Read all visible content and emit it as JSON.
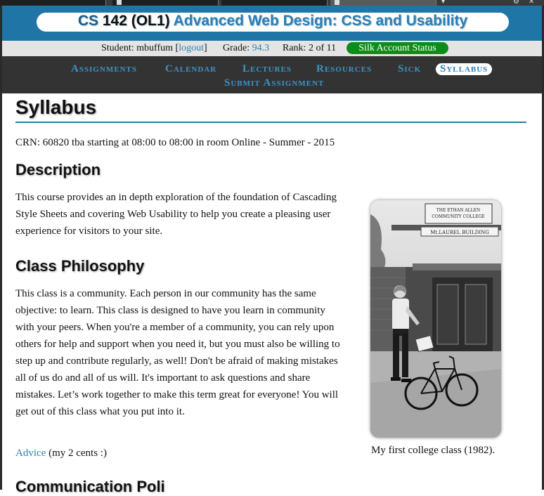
{
  "header": {
    "course_code": "CS",
    "course_number": "142",
    "section": "(OL1)",
    "course_title": "Advanced Web Design: CSS and Usability"
  },
  "userbar": {
    "student_label": "Student: mbuffum [",
    "logout_label": "logout",
    "student_suffix": "]",
    "grade_label": "Grade:",
    "grade_value": "94.3",
    "rank_label": "Rank: 2 of 11",
    "silk_button": "Silk Account Status"
  },
  "nav": {
    "items": [
      "Assignments",
      "Calendar",
      "Lectures",
      "Resources",
      "Sick",
      "Syllabus",
      "Submit Assignment"
    ],
    "active": "Syllabus"
  },
  "page": {
    "title": "Syllabus",
    "crn_line": "CRN: 60820 tba starting at 08:00 to 08:00 in room Online - Summer - 2015",
    "description_heading": "Description",
    "description_text": "This course provides an in depth exploration of the foundation of Cascading Style Sheets and covering Web Usability to help you create a pleasing user experience for visitors to your site.",
    "philosophy_heading": "Class Philosophy",
    "philosophy_text": "This class is a community. Each person in our community has the same objective: to learn. This class is designed to have you learn in community with your peers. When you're a member of a community, you can rely upon others for help and support when you need it, but you must also be willing to step up and contribute regularly, as well! Don't be afraid of making mistakes all of us do and all of us will. It's important to ask questions and share mistakes. Let’s work together to make this term great for everyone! You will get out of this class what you put into it.",
    "advice_link": "Advice",
    "advice_suffix": " (my 2 cents :)",
    "next_heading": "Communication Poli",
    "photo_sign_1": "THE ETHAN ALLEN",
    "photo_sign_2": "COMMUNITY COLLEGE",
    "photo_sign_3": "Mt.LAUREL BUILDING",
    "photo_caption": "My first college class (1982)."
  },
  "colors": {
    "banner": "#1f76a6",
    "nav_bg": "#333333",
    "nav_text": "#3d94c6",
    "link": "#2f7fae",
    "silk_green": "#0c8d1a"
  }
}
